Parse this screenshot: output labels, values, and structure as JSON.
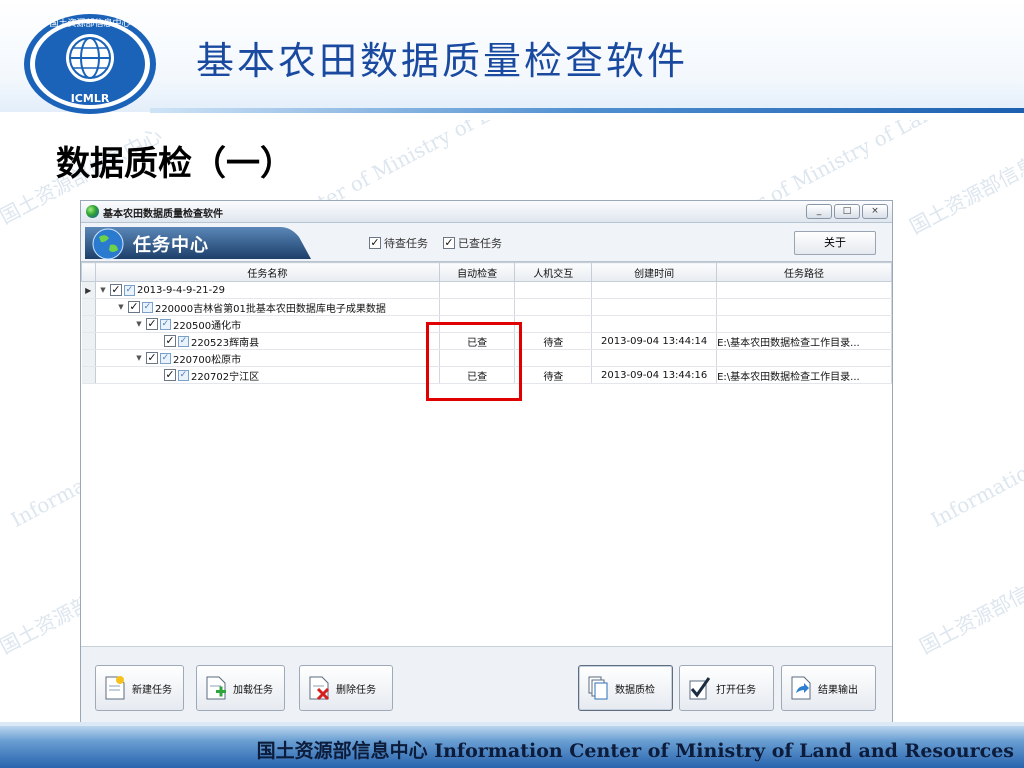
{
  "slide": {
    "title": "基本农田数据质量检查软件",
    "section_title": "数据质检（一）",
    "footer": "国土资源部信息中心 Information Center of Ministry of Land and Resources",
    "logo_text_top": "国土资源部信息中心",
    "logo_text_bottom": "ICMLR"
  },
  "window": {
    "title": "基本农田数据质量检查软件",
    "minimize": "_",
    "maximize": "□",
    "close": "×"
  },
  "header": {
    "title": "任务中心",
    "filter_pending": "待查任务",
    "filter_checked": "已查任务",
    "about": "关于"
  },
  "grid": {
    "columns": [
      "任务名称",
      "自动检查",
      "人机交互",
      "创建时间",
      "任务路径"
    ],
    "rows": [
      {
        "name": "2013-9-4-9-21-29",
        "auto": "",
        "manual": "",
        "time": "",
        "path": ""
      },
      {
        "name": "220000吉林省第01批基本农田数据库电子成果数据",
        "auto": "",
        "manual": "",
        "time": "",
        "path": ""
      },
      {
        "name": "220500通化市",
        "auto": "",
        "manual": "",
        "time": "",
        "path": ""
      },
      {
        "name": "220523辉南县",
        "auto": "已查",
        "manual": "待查",
        "time": "2013-09-04 13:44:14",
        "path": "E:\\基本农田数据检查工作目录..."
      },
      {
        "name": "220700松原市",
        "auto": "",
        "manual": "",
        "time": "",
        "path": ""
      },
      {
        "name": "220702宁江区",
        "auto": "已查",
        "manual": "待查",
        "time": "2013-09-04 13:44:16",
        "path": "E:\\基本农田数据检查工作目录..."
      }
    ]
  },
  "toolbar": {
    "new_task": "新建任务",
    "load_task": "加载任务",
    "delete_task": "删除任务",
    "quality_check": "数据质检",
    "open_task": "打开任务",
    "export_result": "结果输出"
  },
  "watermark": [
    "国土资源部信息中心",
    "Information Center of Ministry of Land and Resources"
  ]
}
